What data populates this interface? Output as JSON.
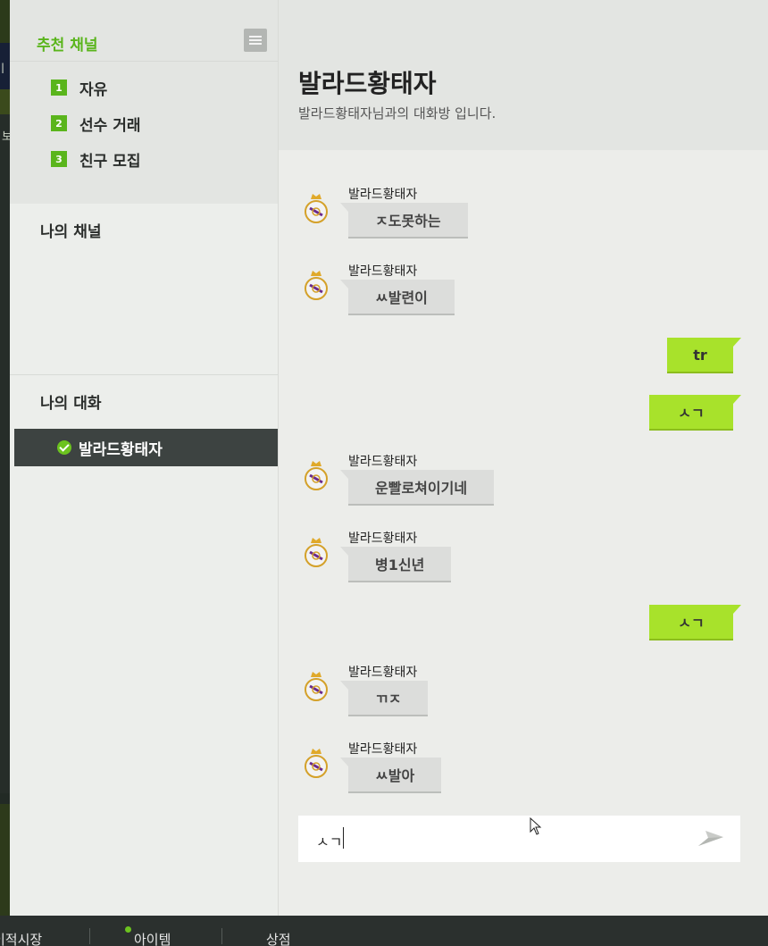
{
  "sidebar": {
    "recommended": {
      "title": "추천 채널",
      "items": [
        {
          "num": "1",
          "label": "자유"
        },
        {
          "num": "2",
          "label": "선수 거래"
        },
        {
          "num": "3",
          "label": "친구 모집"
        }
      ]
    },
    "my_channels_title": "나의 채널",
    "my_conversations_title": "나의 대화",
    "conversations": [
      {
        "label": "발라드황태자"
      }
    ]
  },
  "chat": {
    "title": "발라드황태자",
    "subtitle": "발라드황태자님과의 대화방 입니다.",
    "messages": [
      {
        "dir": "in",
        "sender": "발라드황태자",
        "text": "ㅈ도못하는"
      },
      {
        "dir": "in",
        "sender": "발라드황태자",
        "text": "ㅆ발련이"
      },
      {
        "dir": "out",
        "text": "tr"
      },
      {
        "dir": "out",
        "text": "ㅅㄱ"
      },
      {
        "dir": "in",
        "sender": "발라드황태자",
        "text": "운빨로쳐이기네"
      },
      {
        "dir": "in",
        "sender": "발라드황태자",
        "text": "병1신년"
      },
      {
        "dir": "out",
        "text": "ㅅㄱ"
      },
      {
        "dir": "in",
        "sender": "발라드황태자",
        "text": "ㄲㅈ"
      },
      {
        "dir": "in",
        "sender": "발라드황태자",
        "text": "ㅆ발아"
      }
    ],
    "input_value": "ㅅㄱ"
  },
  "background": {
    "left_text_1": "ㅣ",
    "left_text_2": "보"
  },
  "bottom_bar": {
    "items": [
      "이적시장",
      "아이템",
      "상점"
    ]
  },
  "icons": {
    "menu": "hamburger-menu-icon",
    "check": "check-circle-icon",
    "send": "send-plane-icon",
    "avatar": "club-crest-icon"
  },
  "colors": {
    "accent_green": "#5ab51c",
    "outgoing_bubble": "#a8e22b",
    "incoming_bubble": "#dcdddb",
    "active_conversation": "#3d4341"
  }
}
